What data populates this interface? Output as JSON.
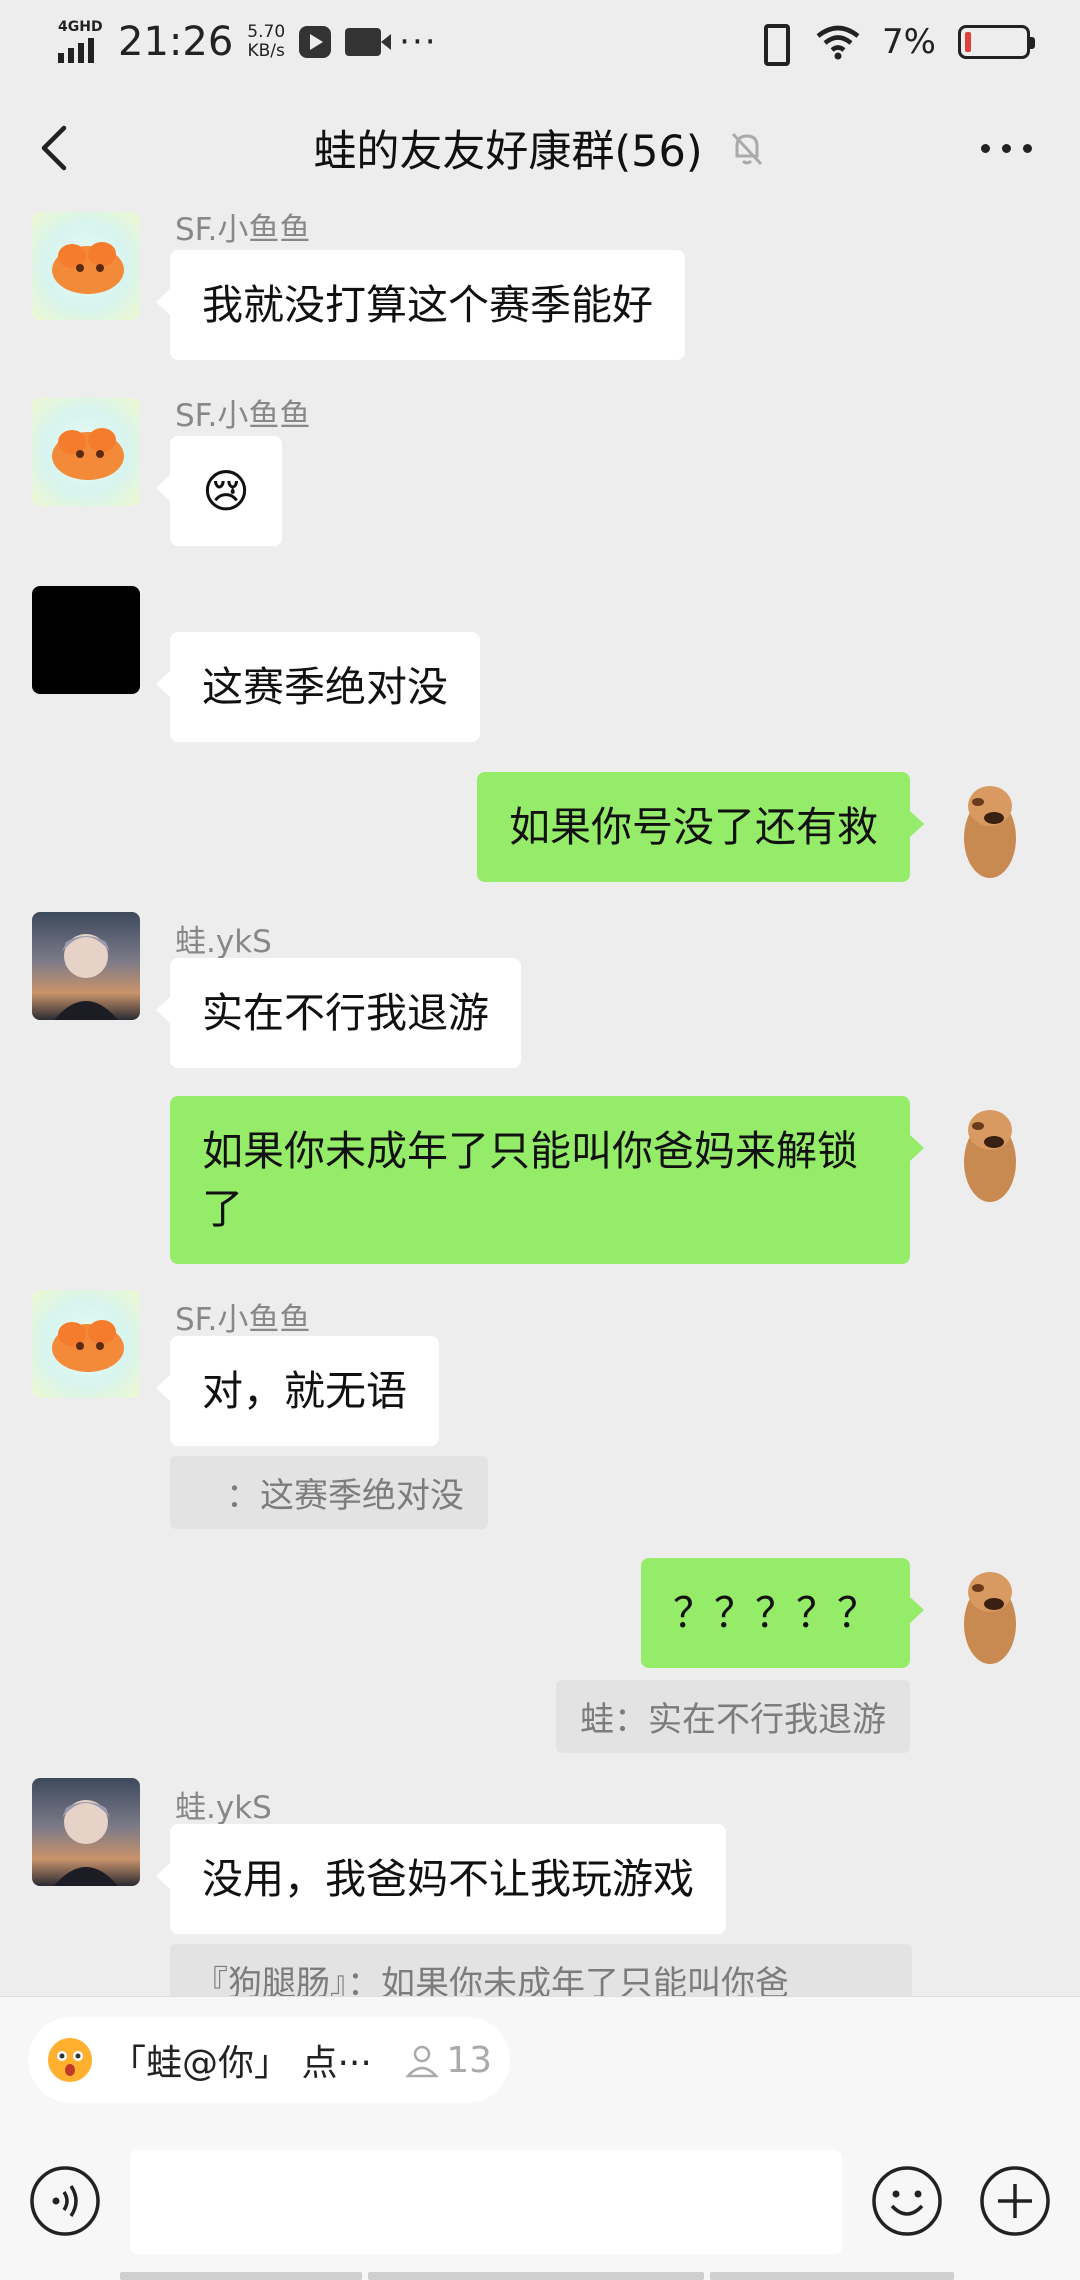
{
  "status_bar": {
    "network": "4GHD",
    "time": "21:26",
    "speed_value": "5.70",
    "speed_unit": "KB/s",
    "more": "···",
    "battery_percent": "7%"
  },
  "header": {
    "title": "蛙的友友好康群(56)"
  },
  "messages": [
    {
      "side": "left",
      "avatar": "fish-avatar",
      "sender": "SF.小鱼鱼",
      "text": "我就没打算这个赛季能好"
    },
    {
      "side": "left",
      "avatar": "fish-avatar",
      "sender": "SF.小鱼鱼",
      "text": "😢"
    },
    {
      "side": "left",
      "avatar": "black-avatar",
      "sender": "",
      "text": "这赛季绝对没"
    },
    {
      "side": "right",
      "avatar": "dog-avatar",
      "text": "如果你号没了还有救"
    },
    {
      "side": "left",
      "avatar": "anime-avatar",
      "sender": "蛙.ykS",
      "text": "实在不行我退游"
    },
    {
      "side": "right",
      "avatar": "dog-avatar",
      "text": "如果你未成年了只能叫你爸妈来解锁了"
    },
    {
      "side": "left",
      "avatar": "fish-avatar",
      "sender": "SF.小鱼鱼",
      "text": "对，就无语",
      "quote": "：这赛季绝对没"
    },
    {
      "side": "right",
      "avatar": "dog-avatar",
      "text": "？？？？？",
      "quote": "蛙：实在不行我退游"
    },
    {
      "side": "left",
      "avatar": "anime-avatar",
      "sender": "蛙.ykS",
      "text": "没用，我爸妈不让我玩游戏",
      "quote": "『狗腿肠』：如果你未成年了只能叫你爸"
    }
  ],
  "mention_bar": {
    "text": "「蛙@你」 点···",
    "count": "13"
  },
  "input": {
    "value": ""
  }
}
